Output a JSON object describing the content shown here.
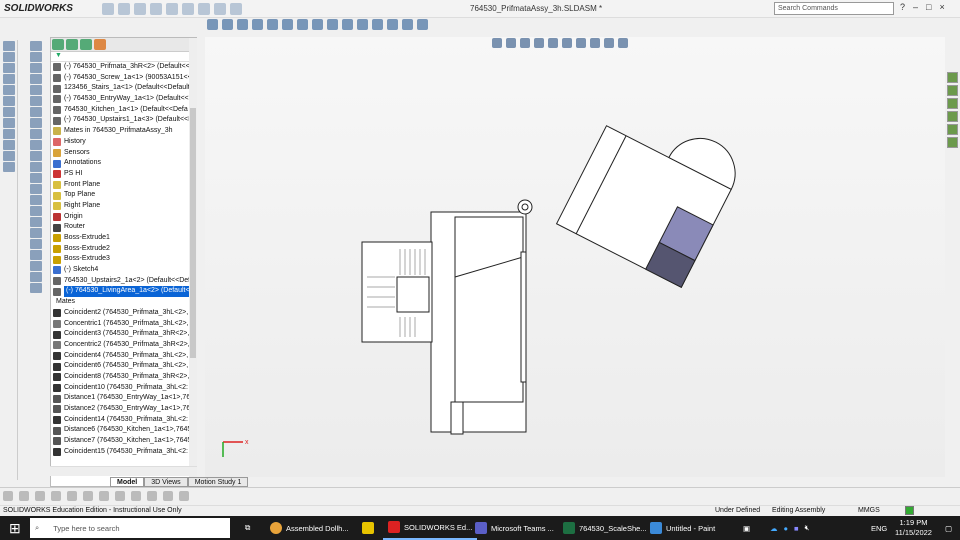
{
  "app": {
    "logo": "SOLIDWORKS",
    "title": "764530_PrifmataAssy_3h.SLDASM *",
    "search_placeholder": "Search Commands"
  },
  "feature_tree": {
    "items": [
      {
        "label": "(-) 764530_Prifmata_3hR<2> (Default<<",
        "icon": "part"
      },
      {
        "label": "(-) 764530_Screw_1a<1> (90053A151<<",
        "icon": "part"
      },
      {
        "label": "123456_Stairs_1a<1> (Default<<Default",
        "icon": "part"
      },
      {
        "label": "(-) 764530_EntryWay_1a<1> (Default<<",
        "icon": "part"
      },
      {
        "label": "764530_Kitchen_1a<1> (Default<<Defa",
        "icon": "part"
      },
      {
        "label": "(-) 764530_Upstairs1_1a<3> (Default<<I",
        "icon": "part"
      },
      {
        "label": "Mates in 764530_PrifmataAssy_3h",
        "icon": "mates"
      },
      {
        "label": "History",
        "icon": "history"
      },
      {
        "label": "Sensors",
        "icon": "sensors"
      },
      {
        "label": "Annotations",
        "icon": "annotations"
      },
      {
        "label": "PS HI",
        "icon": "equations"
      },
      {
        "label": "Front Plane",
        "icon": "plane"
      },
      {
        "label": "Top Plane",
        "icon": "plane"
      },
      {
        "label": "Right Plane",
        "icon": "plane"
      },
      {
        "label": "Origin",
        "icon": "origin"
      },
      {
        "label": "Router",
        "icon": "router"
      },
      {
        "label": "Boss-Extrude1",
        "icon": "extrude"
      },
      {
        "label": "Boss-Extrude2",
        "icon": "extrude"
      },
      {
        "label": "Boss-Extrude3",
        "icon": "extrude"
      },
      {
        "label": "(-) Sketch4",
        "icon": "sketch"
      },
      {
        "label": "764530_Upstairs2_1a<2> (Default<<Def",
        "icon": "part"
      },
      {
        "label": "(-) 764530_LivingArea_1a<2> (Default<",
        "icon": "part",
        "selected": true
      },
      {
        "label": "Mates",
        "icon": "none"
      },
      {
        "label": "Coincident2 (764530_Prifmata_3hL<2>,",
        "icon": "coincident"
      },
      {
        "label": "Concentric1 (764530_Prifmata_3hL<2>,",
        "icon": "concentric"
      },
      {
        "label": "Coincident3 (764530_Prifmata_3hR<2>,",
        "icon": "coincident"
      },
      {
        "label": "Concentric2 (764530_Prifmata_3hR<2>,",
        "icon": "concentric"
      },
      {
        "label": "Coincident4 (764530_Prifmata_3hL<2>,",
        "icon": "coincident"
      },
      {
        "label": "Coincident6 (764530_Prifmata_3hL<2>,",
        "icon": "coincident"
      },
      {
        "label": "Coincident8 (764530_Prifmata_3hR<2>,",
        "icon": "coincident"
      },
      {
        "label": "Coincident10 (764530_Prifmata_3hL<2:",
        "icon": "coincident"
      },
      {
        "label": "Distance1 (764530_EntryWay_1a<1>,76",
        "icon": "distance"
      },
      {
        "label": "Distance2 (764530_EntryWay_1a<1>,76",
        "icon": "distance"
      },
      {
        "label": "Coincident14 (764530_Prifmata_3hL<2:",
        "icon": "coincident"
      },
      {
        "label": "Distance6 (764530_Kitchen_1a<1>,7645",
        "icon": "distance"
      },
      {
        "label": "Distance7 (764530_Kitchen_1a<1>,7645",
        "icon": "distance"
      },
      {
        "label": "Coincident15 (764530_Prifmata_3hL<2:",
        "icon": "coincident"
      }
    ]
  },
  "tabs": [
    {
      "label": "Model",
      "active": true
    },
    {
      "label": "3D Views"
    },
    {
      "label": "Motion Study 1"
    }
  ],
  "status": {
    "edition": "SOLIDWORKS Education Edition - Instructional Use Only",
    "defined": "Under Defined",
    "mode": "Editing Assembly",
    "units": "MMGS"
  },
  "taskbar": {
    "search_placeholder": "Type here to search",
    "apps": [
      {
        "label": "Assembled Dollh...",
        "color": "#e8a33a"
      },
      {
        "label": "",
        "color": "#e8c400"
      },
      {
        "label": "SOLIDWORKS Ed...",
        "color": "#d22",
        "active": true
      },
      {
        "label": "Microsoft Teams ...",
        "color": "#5b5fc7"
      },
      {
        "label": "764530_ScaleShe...",
        "color": "#1d6f42"
      },
      {
        "label": "Untitled - Paint",
        "color": "#3b8ad8"
      }
    ],
    "lang": "ENG",
    "time": "1:19 PM",
    "date": "11/15/2022"
  },
  "colors": {
    "accent": "#0a64d6",
    "roof": "#8a8ab8",
    "roof_dark": "#555570"
  }
}
